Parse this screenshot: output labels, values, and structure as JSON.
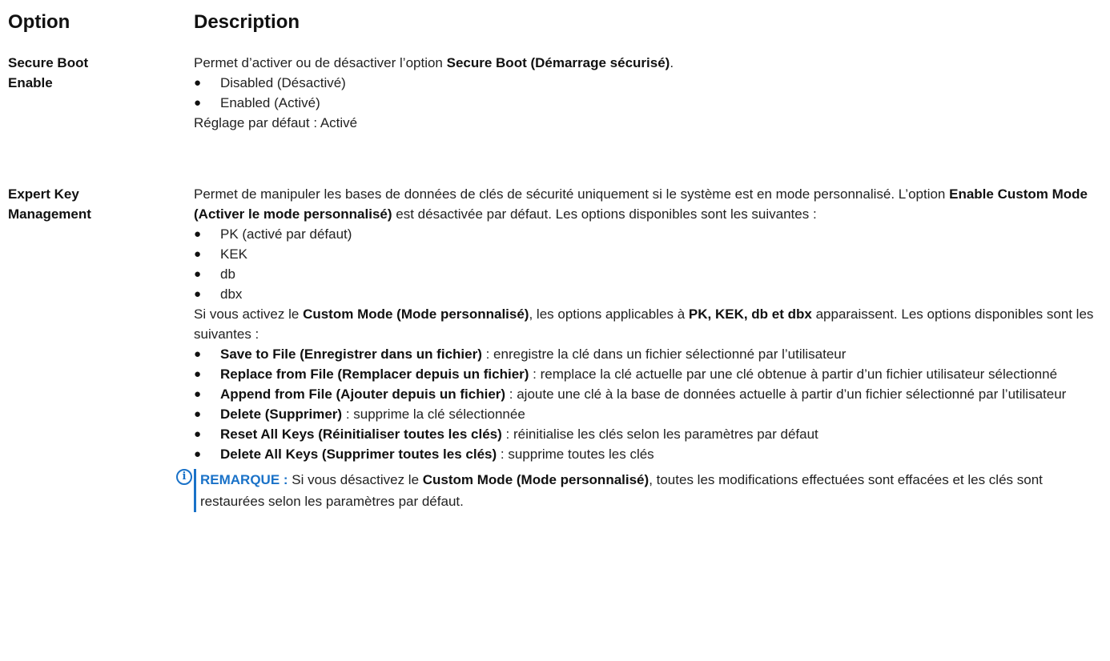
{
  "header": {
    "option": "Option",
    "description": "Description"
  },
  "rows": [
    {
      "option": "Secure Boot\nEnable",
      "intro_pre": "Permet d’activer ou de désactiver l’option ",
      "intro_bold": "Secure Boot (Démarrage sécurisé)",
      "intro_post": ".",
      "bullets": [
        "Disabled (Désactivé)",
        "Enabled (Activé)"
      ],
      "default": "Réglage par défaut : Activé"
    },
    {
      "option": "Expert Key\nManagement",
      "p1_a": "Permet de manipuler les bases de données de clés de sécurité uniquement si le système est en mode personnalisé. L’option ",
      "p1_bold": "Enable Custom Mode (Activer le mode personnalisé)",
      "p1_b": " est désactivée par défaut. Les options disponibles sont les suivantes :",
      "bullets": [
        "PK (activé par défaut)",
        "KEK",
        "db",
        "dbx"
      ],
      "p2_a": "Si vous activez le ",
      "p2_bold1": "Custom Mode (Mode personnalisé)",
      "p2_b": ", les options applicables à ",
      "p2_bold2": "PK, KEK, db et dbx",
      "p2_c": " apparaissent. Les options disponibles sont les suivantes :",
      "actions": [
        {
          "bold": "Save to File (Enregistrer dans un fichier)",
          "text": " : enregistre la clé dans un fichier sélectionné par l’utilisateur"
        },
        {
          "bold": "Replace from File (Remplacer depuis un fichier)",
          "text": " : remplace la clé actuelle par une clé obtenue à partir d’un fichier utilisateur sélectionné"
        },
        {
          "bold": "Append from File (Ajouter depuis un fichier)",
          "text": " : ajoute une clé à la base de données actuelle à partir d’un fichier sélectionné par l’utilisateur"
        },
        {
          "bold": "Delete (Supprimer)",
          "text": " : supprime la clé sélectionnée"
        },
        {
          "bold": "Reset All Keys (Réinitialiser toutes les clés)",
          "text": " : réinitialise les clés selon les paramètres par défaut"
        },
        {
          "bold": "Delete All Keys (Supprimer toutes les clés)",
          "text": " : supprime toutes les clés"
        }
      ],
      "note": {
        "icon": "info-icon",
        "icon_glyph": "i",
        "label": "REMARQUE :",
        "a": " Si vous désactivez le ",
        "bold": "Custom Mode (Mode personnalisé)",
        "b": ", toutes les modifications effectuées sont effacées et les clés sont restaurées selon les paramètres par défaut."
      }
    }
  ],
  "colors": {
    "note_accent": "#1a72c8",
    "text": "#222222"
  }
}
